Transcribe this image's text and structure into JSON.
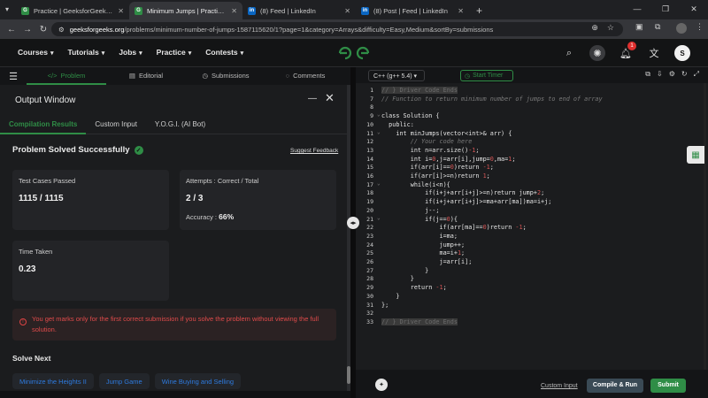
{
  "browser": {
    "tabs": [
      {
        "label": "Practice | GeeksforGeeks | A co",
        "favicon": "gfg-icon",
        "active": false
      },
      {
        "label": "Minimum Jumps | Practice | Gee",
        "favicon": "gfg-icon",
        "active": true
      },
      {
        "label": "(8) Feed | LinkedIn",
        "favicon": "linkedin-icon",
        "active": false
      },
      {
        "label": "(8) Post | Feed | LinkedIn",
        "favicon": "linkedin-icon",
        "active": false
      }
    ],
    "url_domain": "geeksforgeeks.org",
    "url_path": "/problems/minimum-number-of-jumps-1587115620/1?page=1&category=Arrays&difficulty=Easy,Medium&sortBy=submissions"
  },
  "site": {
    "nav": [
      "Courses",
      "Tutorials",
      "Jobs",
      "Practice",
      "Contests"
    ],
    "notification_count": "1",
    "avatar_letter": "S"
  },
  "problem_tabs": [
    "Problem",
    "Editorial",
    "Submissions",
    "Comments"
  ],
  "output": {
    "title": "Output Window",
    "tabs": [
      "Compilation Results",
      "Custom Input",
      "Y.O.G.I. (AI Bot)"
    ],
    "status": "Problem Solved Successfully",
    "feedback_link": "Suggest Feedback",
    "test_cases_label": "Test Cases Passed",
    "test_cases_value": "1115 / 1115",
    "attempts_label": "Attempts : Correct / Total",
    "attempts_value": "2 / 3",
    "accuracy_label": "Accuracy :",
    "accuracy_value": "66%",
    "time_label": "Time Taken",
    "time_value": "0.23",
    "warning": "You get marks only for the first correct submission if you solve the problem without viewing the full solution.",
    "solve_next_title": "Solve Next",
    "solve_next": [
      "Minimize the Heights II",
      "Jump Game",
      "Wine Buying and Selling"
    ]
  },
  "editor": {
    "language": "C++ (g++ 5.4)",
    "timer_label": "Start Timer",
    "lines": [
      {
        "n": "1",
        "text": "// } Driver Code Ends",
        "cls": "hl",
        "fold": ""
      },
      {
        "n": "7",
        "text": "// Function to return minimum number of jumps to end of array",
        "cls": "cm",
        "fold": ""
      },
      {
        "n": "8",
        "text": "",
        "cls": "",
        "fold": ""
      },
      {
        "n": "9",
        "text": "class Solution {",
        "cls": "",
        "fold": "⌄"
      },
      {
        "n": "10",
        "text": "  public:",
        "cls": "",
        "fold": ""
      },
      {
        "n": "11",
        "text": "    int minJumps(vector<int>& arr) {",
        "cls": "",
        "fold": "⌄"
      },
      {
        "n": "12",
        "text": "        // Your code here",
        "cls": "cm",
        "fold": ""
      },
      {
        "n": "13",
        "text": "        int n=arr.size()-1;",
        "cls": "",
        "fold": ""
      },
      {
        "n": "14",
        "text": "        int i=0,j=arr[i],jump=0,ma=1;",
        "cls": "",
        "fold": ""
      },
      {
        "n": "15",
        "text": "        if(arr[i]==0)return -1;",
        "cls": "",
        "fold": ""
      },
      {
        "n": "16",
        "text": "        if(arr[i]>=n)return 1;",
        "cls": "",
        "fold": ""
      },
      {
        "n": "17",
        "text": "        while(i<n){",
        "cls": "",
        "fold": "⌄"
      },
      {
        "n": "18",
        "text": "            if(i+j+arr[i+j]>=n)return jump+2;",
        "cls": "",
        "fold": ""
      },
      {
        "n": "19",
        "text": "            if(i+j+arr[i+j]>=ma+arr[ma])ma=i+j;",
        "cls": "",
        "fold": ""
      },
      {
        "n": "20",
        "text": "            j--;",
        "cls": "",
        "fold": ""
      },
      {
        "n": "21",
        "text": "            if(j==0){",
        "cls": "",
        "fold": "⌄"
      },
      {
        "n": "22",
        "text": "                if(arr[ma]==0)return -1;",
        "cls": "",
        "fold": ""
      },
      {
        "n": "23",
        "text": "                i=ma;",
        "cls": "",
        "fold": ""
      },
      {
        "n": "24",
        "text": "                jump++;",
        "cls": "",
        "fold": ""
      },
      {
        "n": "25",
        "text": "                ma=i+1;",
        "cls": "",
        "fold": ""
      },
      {
        "n": "26",
        "text": "                j=arr[i];",
        "cls": "",
        "fold": ""
      },
      {
        "n": "27",
        "text": "            }",
        "cls": "",
        "fold": ""
      },
      {
        "n": "28",
        "text": "        }",
        "cls": "",
        "fold": ""
      },
      {
        "n": "29",
        "text": "        return -1;",
        "cls": "",
        "fold": ""
      },
      {
        "n": "30",
        "text": "    }",
        "cls": "",
        "fold": ""
      },
      {
        "n": "31",
        "text": "};",
        "cls": "",
        "fold": ""
      },
      {
        "n": "32",
        "text": "",
        "cls": "",
        "fold": ""
      },
      {
        "n": "33",
        "text": "// } Driver Code Ends",
        "cls": "hl",
        "fold": ""
      }
    ]
  },
  "footer": {
    "custom_input": "Custom Input",
    "compile_run": "Compile & Run",
    "submit": "Submit"
  },
  "colors": {
    "accent": "#2f8d46",
    "error": "#e04b4b",
    "link": "#2e7be0"
  }
}
